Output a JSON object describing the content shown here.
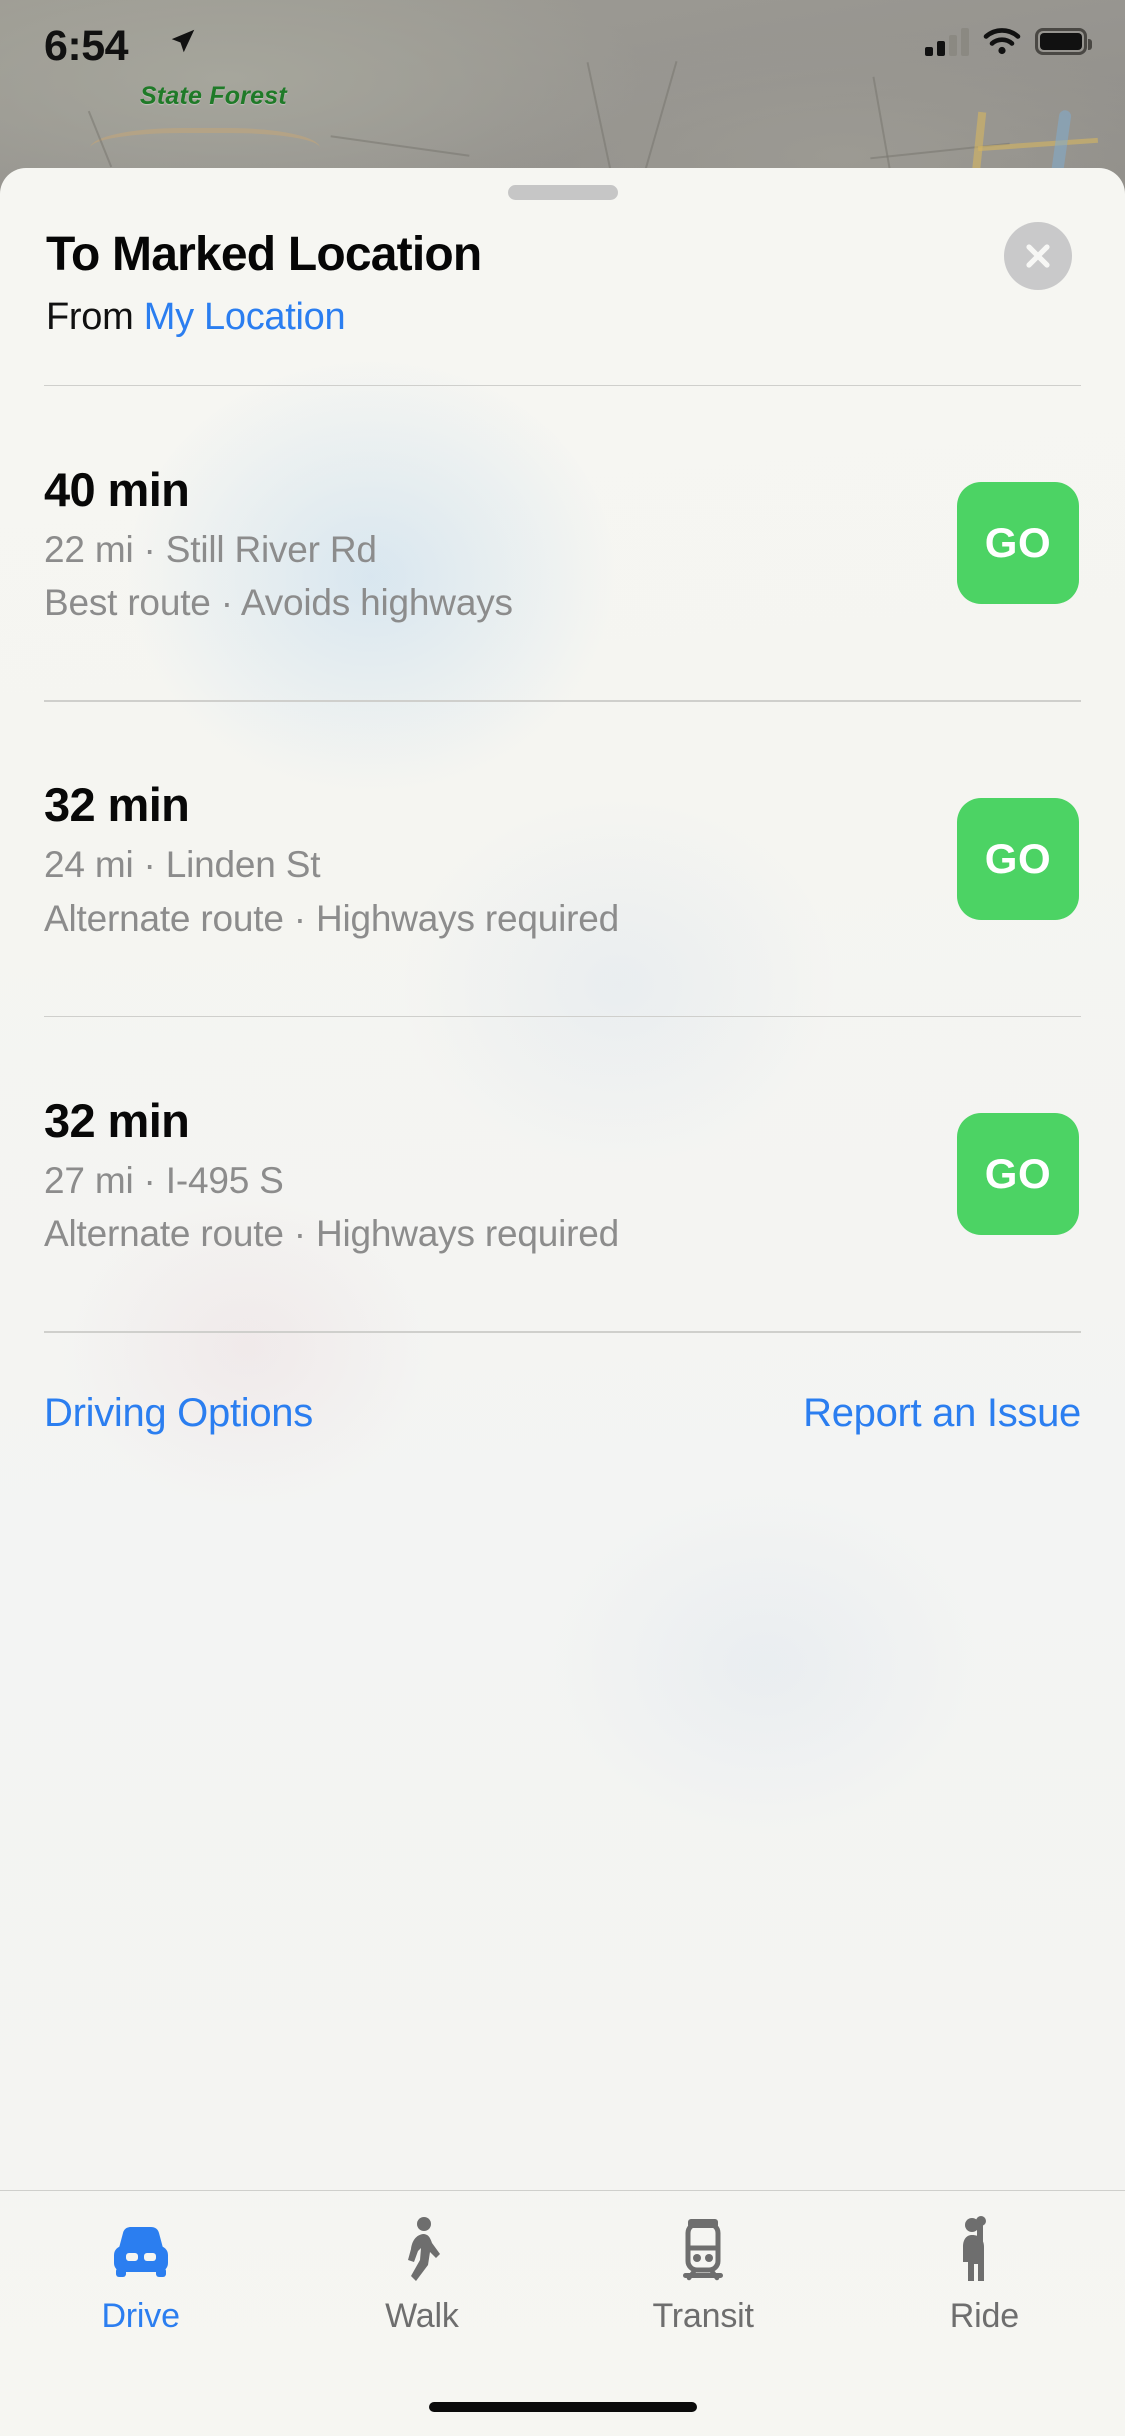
{
  "status_bar": {
    "time": "6:54",
    "location_arrow_icon": "location-arrow-icon",
    "cellular_icon": "cellular-signal-icon",
    "cellular_bars_filled": 2,
    "cellular_bars_total": 4,
    "wifi_icon": "wifi-icon",
    "battery_icon": "battery-full-icon"
  },
  "map": {
    "label": "State Forest",
    "label_color": "#1f7a28"
  },
  "sheet": {
    "grabber": "sheet-grabber-handle",
    "title": "To Marked Location",
    "from_prefix": "From ",
    "from_link": "My Location",
    "close_icon": "close-icon"
  },
  "routes": [
    {
      "eta": "40 min",
      "meta": "22 mi · Still River Rd",
      "description": "Best route · Avoids highways",
      "go_label": "GO"
    },
    {
      "eta": "32 min",
      "meta": "24 mi · Linden St",
      "description": "Alternate route · Highways required",
      "go_label": "GO"
    },
    {
      "eta": "32 min",
      "meta": "27 mi · I-495 S",
      "description": "Alternate route · Highways required",
      "go_label": "GO"
    }
  ],
  "links": {
    "driving_options": "Driving Options",
    "report_issue": "Report an Issue"
  },
  "tab_bar": {
    "items": [
      {
        "label": "Drive",
        "icon": "car-icon",
        "active": true
      },
      {
        "label": "Walk",
        "icon": "walk-icon",
        "active": false
      },
      {
        "label": "Transit",
        "icon": "train-icon",
        "active": false
      },
      {
        "label": "Ride",
        "icon": "rideshare-icon",
        "active": false
      }
    ]
  },
  "colors": {
    "accent_blue": "#2b7ef0",
    "go_green": "#4cd364",
    "sheet_bg": "#f5f5f1",
    "secondary_text": "#8c8c8c"
  }
}
